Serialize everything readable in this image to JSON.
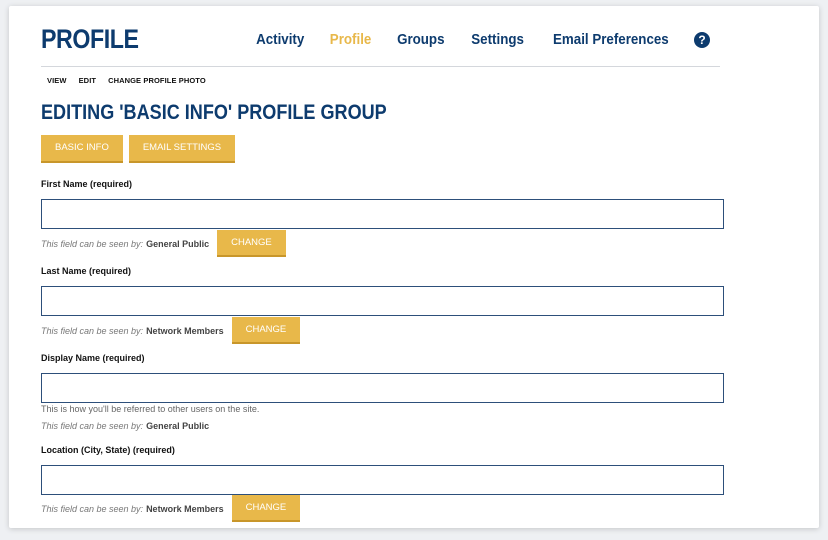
{
  "header": {
    "title": "PROFILE",
    "nav": [
      "Activity",
      "Profile",
      "Groups",
      "Settings",
      "Email Preferences"
    ],
    "active_nav": "Profile",
    "help_symbol": "?"
  },
  "subnav": [
    "VIEW",
    "EDIT",
    "CHANGE PROFILE PHOTO"
  ],
  "section_title": "EDITING 'BASIC INFO' PROFILE GROUP",
  "tabs": [
    "BASIC INFO",
    "EMAIL SETTINGS"
  ],
  "visibility_lead": "This field can be seen by:",
  "change_label": "CHANGE",
  "fields": [
    {
      "label": "First Name (required)",
      "value": "",
      "visibility": "General Public",
      "has_change": true
    },
    {
      "label": "Last Name (required)",
      "value": "",
      "visibility": "Network Members",
      "has_change": true
    },
    {
      "label": "Display Name (required)",
      "value": "",
      "help": "This is how you'll be referred to other users on the site.",
      "visibility": "General Public",
      "has_change": false
    },
    {
      "label": "Location (City, State) (required)",
      "value": "",
      "visibility": "Network Members",
      "has_change": true
    }
  ],
  "colors": {
    "brand_navy": "#0d3b6e",
    "accent_gold": "#e8b84a"
  }
}
